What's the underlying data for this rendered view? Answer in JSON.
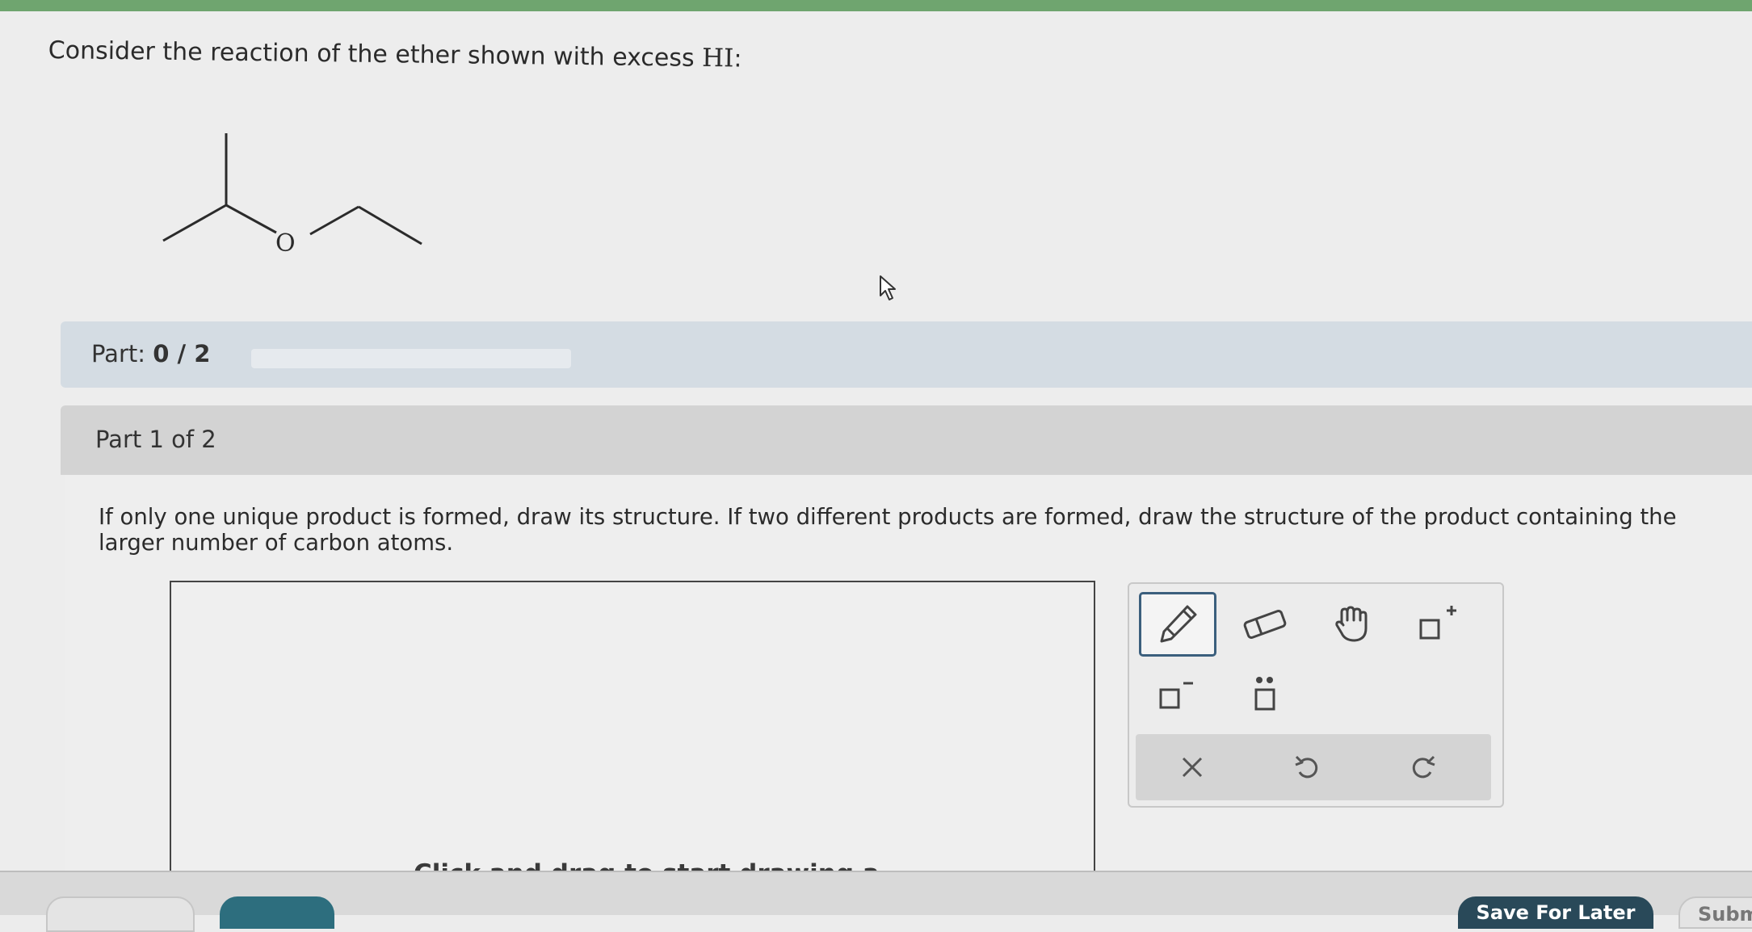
{
  "question": {
    "text": "Consider the reaction of the ether shown with excess ",
    "reagent": "HI",
    "suffix": ":"
  },
  "molecule": {
    "oxygen_label": "O"
  },
  "part_progress": {
    "label": "Part: ",
    "current": "0",
    "separator": " / ",
    "total": "2",
    "fraction_complete": 0
  },
  "part_header": {
    "label": "Part 1 of 2"
  },
  "instructions": "If only one unique product is formed, draw its structure. If two different products are formed, draw the structure of the product containing the larger number of carbon atoms.",
  "canvas": {
    "hint": "Click and drag to start drawing a"
  },
  "toolbox": {
    "tools": [
      {
        "name": "pencil-icon",
        "active": true
      },
      {
        "name": "eraser-icon",
        "active": false
      },
      {
        "name": "hand-icon",
        "active": false
      },
      {
        "name": "positive-charge-icon",
        "active": false
      },
      {
        "name": "negative-charge-icon",
        "active": false
      },
      {
        "name": "lone-pair-icon",
        "active": false
      }
    ],
    "actions": [
      "clear-icon",
      "undo-icon",
      "redo-icon"
    ]
  },
  "footer": {
    "save_label": "Save For Later",
    "submit_label": "Subm"
  },
  "colors": {
    "top_strip": "#6fa56f",
    "part_bar": "#d4dce3",
    "teal_button": "#2d6e7e",
    "navy_button": "#294959",
    "active_tool_border": "#3b5f7d"
  }
}
